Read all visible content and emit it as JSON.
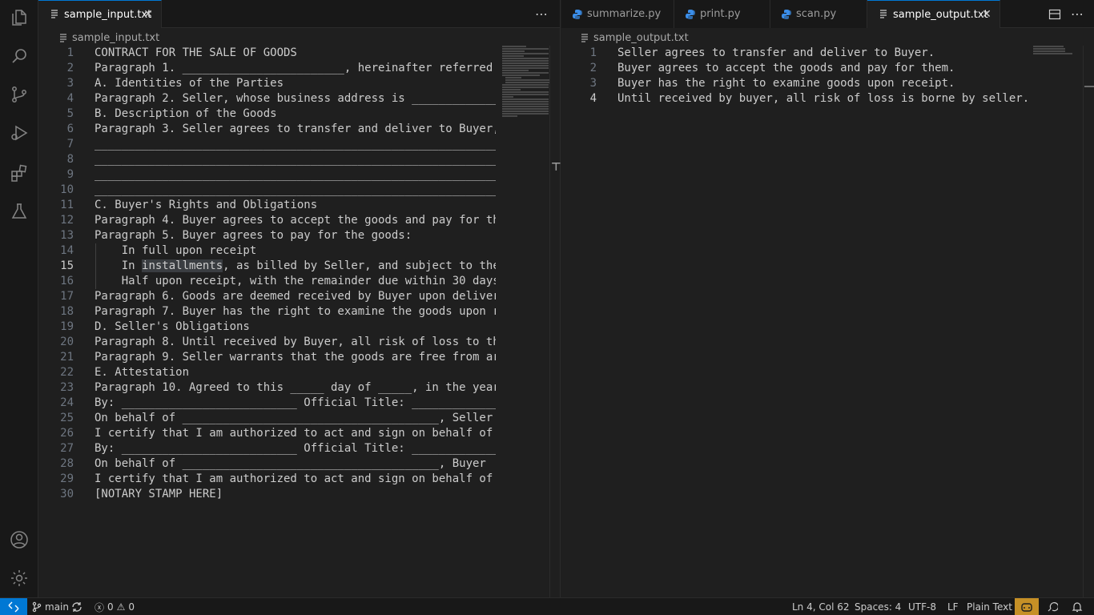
{
  "editor_left": {
    "tab": {
      "label": "sample_input.txt",
      "icon": "file-lines-icon"
    },
    "breadcrumb": "sample_input.txt",
    "current_line": 15,
    "lines": [
      "CONTRACT FOR THE SALE OF GOODS",
      "Paragraph 1. ________________________, hereinafter referred t",
      "A. Identities of the Parties",
      "Paragraph 2. Seller, whose business address is _____________",
      "B. Description of the Goods",
      "Paragraph 3. Seller agrees to transfer and deliver to Buyer,",
      "____________________________________________________________",
      "____________________________________________________________",
      "____________________________________________________________",
      "____________________________________________________________",
      "C. Buyer's Rights and Obligations",
      "Paragraph 4. Buyer agrees to accept the goods and pay for th",
      "Paragraph 5. Buyer agrees to pay for the goods:",
      "    In full upon receipt",
      "    In installments, as billed by Seller, and subject to the",
      "    Half upon receipt, with the remainder due within 30 days",
      "Paragraph 6. Goods are deemed received by Buyer upon deliver",
      "Paragraph 7. Buyer has the right to examine the goods upon r",
      "D. Seller's Obligations",
      "Paragraph 8. Until received by Buyer, all risk of loss to th",
      "Paragraph 9. Seller warrants that the goods are free from ar",
      "E. Attestation",
      "Paragraph 10. Agreed to this _____ day of _____, in the year",
      "By: __________________________ Official Title: _____________",
      "On behalf of ______________________________________, Seller ",
      "I certify that I am authorized to act and sign on behalf of ",
      "By: __________________________ Official Title: _____________",
      "On behalf of ______________________________________, Buyer",
      "I certify that I am authorized to act and sign on behalf of ",
      "[NOTARY STAMP HERE]"
    ],
    "highlight_word": "installments"
  },
  "editor_right": {
    "tabs": [
      {
        "label": "summarize.py",
        "icon": "python-icon"
      },
      {
        "label": "print.py",
        "icon": "python-icon"
      },
      {
        "label": "scan.py",
        "icon": "python-icon"
      },
      {
        "label": "sample_output.txt",
        "icon": "file-lines-icon",
        "active": true
      }
    ],
    "breadcrumb": "sample_output.txt",
    "current_line": 4,
    "lines": [
      "Seller agrees to transfer and deliver to Buyer.",
      "Buyer agrees to accept the goods and pay for them.",
      "Buyer has the right to examine goods upon receipt.",
      "Until received by buyer, all risk of loss is borne by seller."
    ]
  },
  "activity_bar": {
    "top": [
      "explorer-icon",
      "search-icon",
      "source-control-icon",
      "run-debug-icon",
      "extensions-icon",
      "testing-icon"
    ],
    "bottom": [
      "account-icon",
      "manage-gear-icon"
    ]
  },
  "status_bar": {
    "branch": "main",
    "errors": "0",
    "warnings": "0",
    "cursor": "Ln 4, Col 62",
    "indent": "Spaces: 4",
    "encoding": "UTF-8",
    "eol": "LF",
    "language": "Plain Text",
    "colors": {
      "remote_bg": "#0078d4",
      "copilot_bg": "#c69026"
    }
  },
  "colors": {
    "python_icon": "#3b8eea",
    "accent": "#0078d4"
  }
}
